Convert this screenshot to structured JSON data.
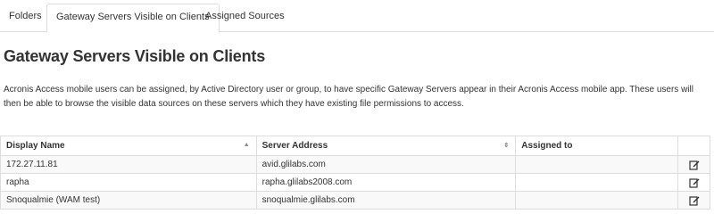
{
  "tabs": [
    {
      "label": "Folders",
      "active": false
    },
    {
      "label": "Gateway Servers Visible on Clients",
      "active": true
    },
    {
      "label": "Assigned Sources",
      "active": false
    }
  ],
  "page": {
    "title": "Gateway Servers Visible on Clients",
    "description": "Acronis Access mobile users can be assigned, by Active Directory user or group, to have specific Gateway Servers appear in their Acronis Access mobile app. These users will then be able to browse the visible data sources on these servers which they have existing file permissions to access."
  },
  "table": {
    "columns": [
      {
        "label": "Display Name",
        "sort_icon": "sort-asc-icon"
      },
      {
        "label": "Server Address",
        "sort_icon": "sort-both-icon"
      },
      {
        "label": "Assigned to"
      },
      {
        "label": ""
      }
    ],
    "rows": [
      {
        "display_name": "172.27.11.81",
        "server_address": "avid.glilabs.com",
        "assigned_to": "",
        "action_icon": "edit-icon"
      },
      {
        "display_name": "rapha",
        "server_address": "rapha.glilabs2008.com",
        "assigned_to": "",
        "action_icon": "edit-icon"
      },
      {
        "display_name": "Snoqualmie (WAM test)",
        "server_address": "snoqualmie.glilabs.com",
        "assigned_to": "",
        "action_icon": "edit-icon"
      }
    ]
  },
  "colors": {
    "text": "#333333",
    "border": "#dddddd",
    "row_alt": "#f9f9f9"
  }
}
